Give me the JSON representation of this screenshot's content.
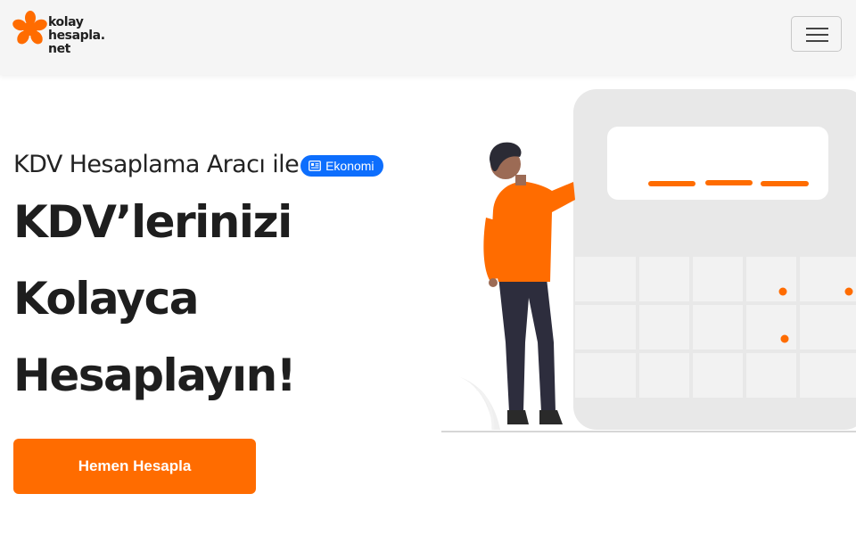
{
  "brand": {
    "logo_lines": [
      "kolay",
      "hesapla.",
      "net"
    ],
    "accent_color": "#ff6c00"
  },
  "nav": {
    "menu_icon": "hamburger-menu-icon"
  },
  "hero": {
    "subtitle": "KDV Hesaplama Aracı ile",
    "category_badge": {
      "label": "Ekonomi",
      "icon": "newspaper-icon",
      "color": "#0d6efd"
    },
    "headline_lines": [
      "KDV’lerinizi",
      "Kolayca",
      "Hesaplayın!"
    ],
    "cta_label": "Hemen Hesapla"
  },
  "illustration": {
    "subject": "person-pointing-at-calculator"
  }
}
